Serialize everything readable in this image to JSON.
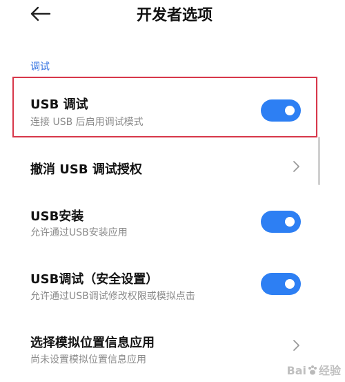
{
  "header": {
    "title": "开发者选项",
    "back_icon": "back-arrow-icon"
  },
  "section": {
    "title": "调试"
  },
  "items": [
    {
      "title": "USB 调试",
      "subtitle": "连接 USB 后启用调试模式",
      "control": "toggle",
      "toggle_on": true,
      "highlighted": true
    },
    {
      "title": "撤消 USB 调试授权",
      "control": "chevron"
    },
    {
      "title": "USB安装",
      "subtitle": "允许通过USB安装应用",
      "control": "toggle",
      "toggle_on": true
    },
    {
      "title": "USB调试（安全设置）",
      "subtitle": "允许通过USB调试修改权限或模拟点击",
      "control": "toggle",
      "toggle_on": true
    },
    {
      "title": "选择模拟位置信息应用",
      "subtitle": "尚未设置模拟位置信息应用",
      "control": "chevron"
    }
  ],
  "colors": {
    "accent": "#2d7ff3",
    "section_header": "#2f6fe0",
    "highlight": "#d7374a",
    "subtitle": "#8a8a8a"
  },
  "watermark": {
    "text_left": "Bai",
    "text_right": "经验"
  }
}
